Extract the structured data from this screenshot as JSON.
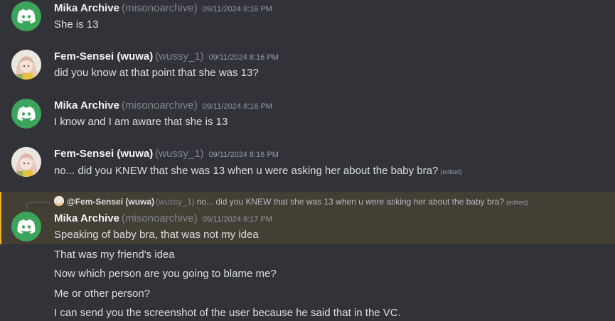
{
  "messages": [
    {
      "author": "Mika Archive",
      "handle": "(misonoarchive)",
      "timestamp": "09/11/2024 8:16 PM",
      "lines": [
        "She is 13"
      ]
    },
    {
      "author": "Fem-Sensei (wuwa)",
      "handle": "(wussy_1)",
      "timestamp": "09/11/2024 8:16 PM",
      "lines": [
        "did you know at that point that she was 13?"
      ]
    },
    {
      "author": "Mika Archive",
      "handle": "(misonoarchive)",
      "timestamp": "09/11/2024 8:16 PM",
      "lines": [
        "I know and I am aware that she is 13"
      ]
    },
    {
      "author": "Fem-Sensei (wuwa)",
      "handle": "(wussy_1)",
      "timestamp": "09/11/2024 8:16 PM",
      "lines": [
        "no... did you KNEW that she was 13 when u were asking her about the baby bra?"
      ],
      "edited": "(edited)"
    },
    {
      "author": "Mika Archive",
      "handle": "(misonoarchive)",
      "timestamp": "09/11/2024 8:17 PM",
      "reply": {
        "author": "@Fem-Sensei (wuwa)",
        "handle": "(wussy_1)",
        "text": "no... did you KNEW that she was 13 when u were asking her about the baby bra?",
        "edited": "(edited)"
      },
      "lines": [
        "Speaking of baby bra, that was not my idea",
        "That was my friend's idea",
        "Now which person are you going to blame me?",
        "Me or other person?",
        "I can send you the screenshot of the user because he said that in the VC."
      ]
    }
  ],
  "icons": {
    "discord_avatar": "discord-logo-icon",
    "anime_avatar": "anime-girl-avatar"
  },
  "colors": {
    "background": "#313338",
    "highlight": "#443f35",
    "highlight_bar": "#f0b232",
    "discord_green": "#3ba55c"
  }
}
